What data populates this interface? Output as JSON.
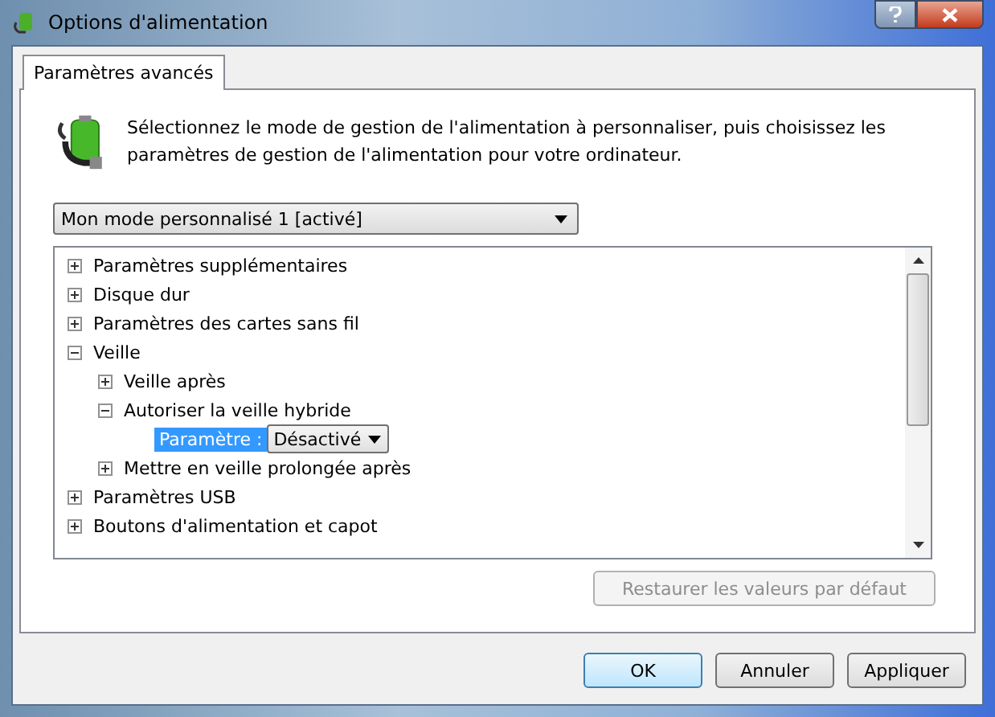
{
  "window": {
    "title": "Options d'alimentation"
  },
  "tabs": [
    {
      "label": "Paramètres avancés",
      "selected": true
    }
  ],
  "description": "Sélectionnez le mode de gestion de l'alimentation à personnaliser, puis choisissez les paramètres de gestion de l'alimentation pour votre ordinateur.",
  "plan_dropdown": {
    "value": "Mon mode personnalisé 1 [activé]"
  },
  "tree": [
    {
      "kind": "node",
      "label": "Paramètres supplémentaires",
      "expanded": false
    },
    {
      "kind": "node",
      "label": "Disque dur",
      "expanded": false
    },
    {
      "kind": "node",
      "label": "Paramètres des cartes sans fil",
      "expanded": false
    },
    {
      "kind": "node",
      "label": "Veille",
      "expanded": true,
      "children": [
        {
          "kind": "node",
          "label": "Veille après",
          "expanded": false
        },
        {
          "kind": "node",
          "label": "Autoriser la veille hybride",
          "expanded": true,
          "children": [
            {
              "kind": "setting",
              "label": "Paramètre :",
              "value": "Désactivé",
              "selected": true
            }
          ]
        },
        {
          "kind": "node",
          "label": "Mettre en veille prolongée après",
          "expanded": false
        }
      ]
    },
    {
      "kind": "node",
      "label": "Paramètres USB",
      "expanded": false
    },
    {
      "kind": "node",
      "label": "Boutons d'alimentation et capot",
      "expanded": false
    }
  ],
  "restore_button": {
    "label": "Restaurer les valeurs par défaut",
    "disabled": true
  },
  "buttons": [
    {
      "label": "OK",
      "default": true
    },
    {
      "label": "Annuler",
      "default": false
    },
    {
      "label": "Appliquer",
      "default": false
    }
  ]
}
